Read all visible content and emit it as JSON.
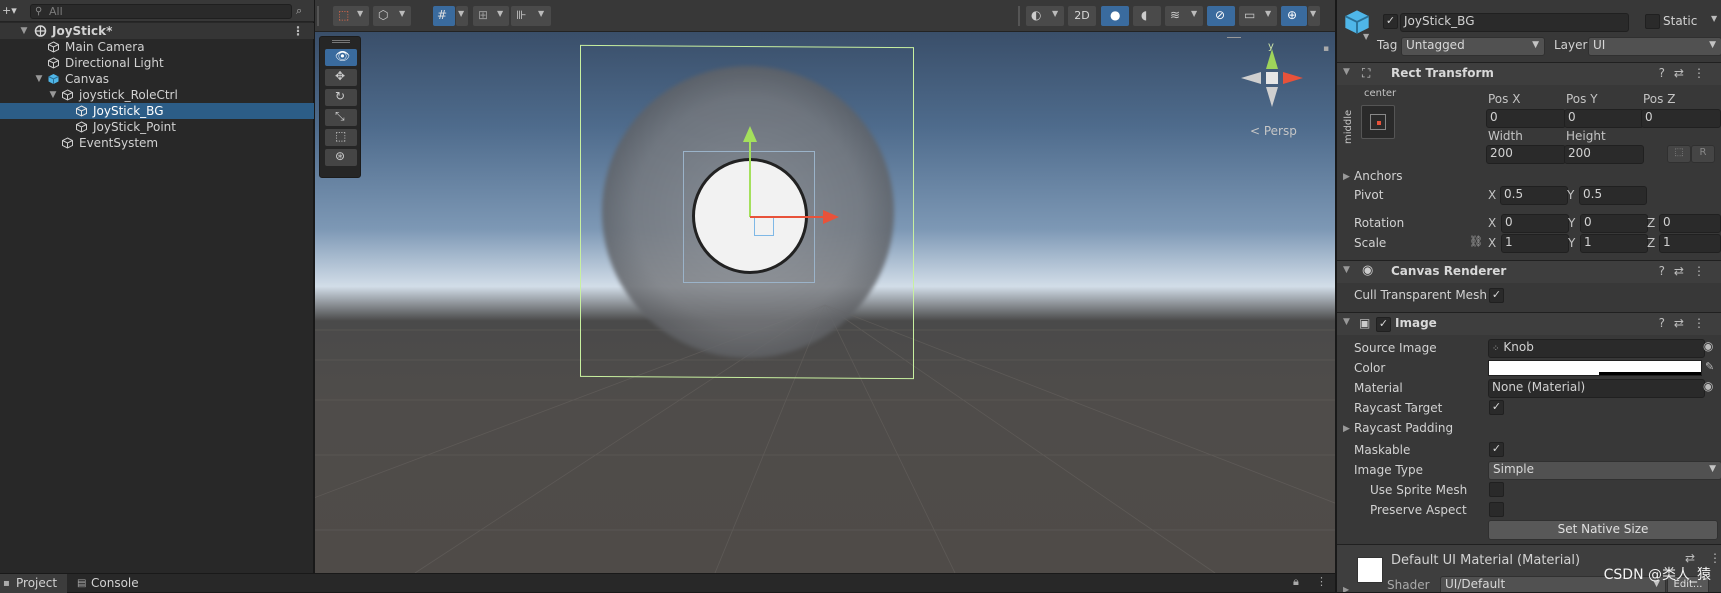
{
  "hierarchy": {
    "search_placeholder": "All",
    "scene_name": "JoyStick*",
    "items": [
      {
        "label": "Main Camera"
      },
      {
        "label": "Directional Light"
      },
      {
        "label": "Canvas"
      },
      {
        "label": "joystick_RoleCtrl"
      },
      {
        "label": "JoyStick_BG"
      },
      {
        "label": "JoyStick_Point"
      },
      {
        "label": "EventSystem"
      }
    ]
  },
  "bottom_tabs": {
    "project": "Project",
    "console": "Console"
  },
  "scene": {
    "btn_2d": "2D",
    "persp_label": "< Persp",
    "gizmo_y": "y"
  },
  "inspector": {
    "object_name": "JoyStick_BG",
    "static_label": "Static",
    "tag_label": "Tag",
    "tag_value": "Untagged",
    "layer_label": "Layer",
    "layer_value": "UI",
    "rect_transform": {
      "title": "Rect Transform",
      "anchor_h": "center",
      "anchor_v": "middle",
      "pos_x_label": "Pos X",
      "pos_x": "0",
      "pos_y_label": "Pos Y",
      "pos_y": "0",
      "pos_z_label": "Pos Z",
      "pos_z": "0",
      "width_label": "Width",
      "width": "200",
      "height_label": "Height",
      "height": "200",
      "r_button": "R",
      "anchors_label": "Anchors",
      "pivot_label": "Pivot",
      "pivot_x": "0.5",
      "pivot_y": "0.5",
      "rotation_label": "Rotation",
      "rot_x": "0",
      "rot_y": "0",
      "rot_z": "0",
      "scale_label": "Scale",
      "scale_x": "1",
      "scale_y": "1",
      "scale_z": "1",
      "x": "X",
      "y": "Y",
      "z": "Z"
    },
    "canvas_renderer": {
      "title": "Canvas Renderer",
      "cull_label": "Cull Transparent Mesh"
    },
    "image": {
      "title": "Image",
      "source_image_label": "Source Image",
      "source_image": "Knob",
      "color_label": "Color",
      "material_label": "Material",
      "material": "None (Material)",
      "raycast_target_label": "Raycast Target",
      "raycast_padding_label": "Raycast Padding",
      "maskable_label": "Maskable",
      "image_type_label": "Image Type",
      "image_type": "Simple",
      "use_sprite_mesh_label": "Use Sprite Mesh",
      "preserve_aspect_label": "Preserve Aspect",
      "set_native_size": "Set Native Size"
    },
    "material_footer": {
      "title": "Default UI Material (Material)",
      "shader_label": "Shader",
      "shader_value": "UI/Default",
      "edit_button": "Edit..."
    }
  },
  "watermark": "CSDN @类人_猿",
  "colors": {
    "selection": "#2c5d87",
    "accent": "#3a6b9e",
    "rect_outline": "#c8f0a0"
  }
}
